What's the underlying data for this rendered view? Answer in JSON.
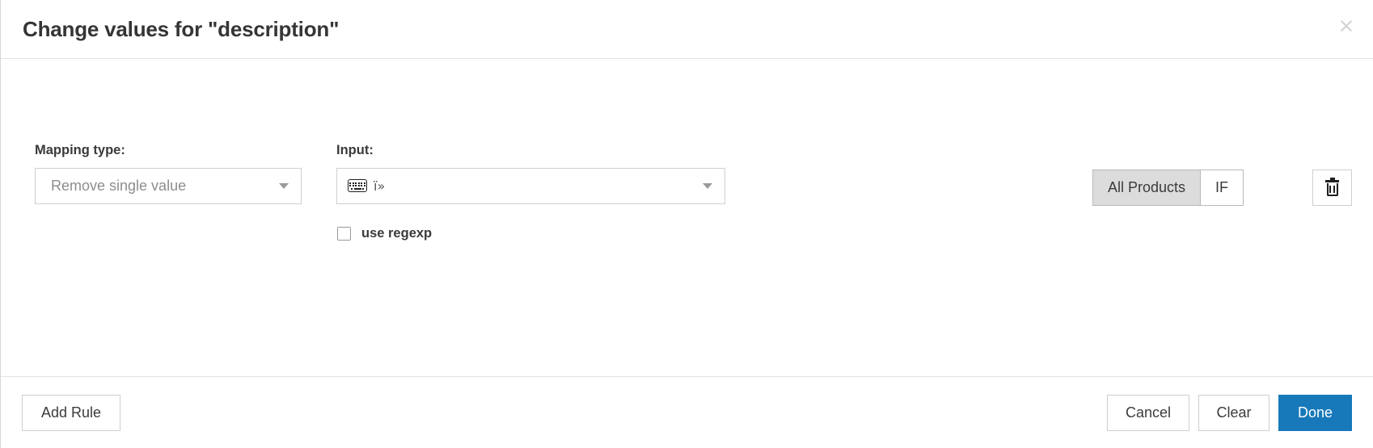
{
  "dialog": {
    "title": "Change values for \"description\"",
    "close_label": "×",
    "close_icon": "close-icon"
  },
  "rule": {
    "mapping": {
      "label": "Mapping type:",
      "selected": "Remove single value",
      "caret_icon": "chevron-down-icon"
    },
    "input": {
      "label": "Input:",
      "value": "ï»",
      "keyboard_icon": "keyboard-icon",
      "caret_icon": "chevron-down-icon"
    },
    "regexp": {
      "label": "use regexp",
      "checked": false
    },
    "scope": {
      "all_products_label": "All Products",
      "if_label": "IF",
      "active": "All Products"
    },
    "delete": {
      "icon": "trash-icon"
    }
  },
  "footer": {
    "add_rule_label": "Add Rule",
    "cancel_label": "Cancel",
    "clear_label": "Clear",
    "done_label": "Done"
  },
  "colors": {
    "primary": "#1779ba",
    "border": "#cfcfcf",
    "active_segment": "#dcdcdc",
    "text": "#3b3b3b",
    "muted_text": "#8d8d8d"
  }
}
